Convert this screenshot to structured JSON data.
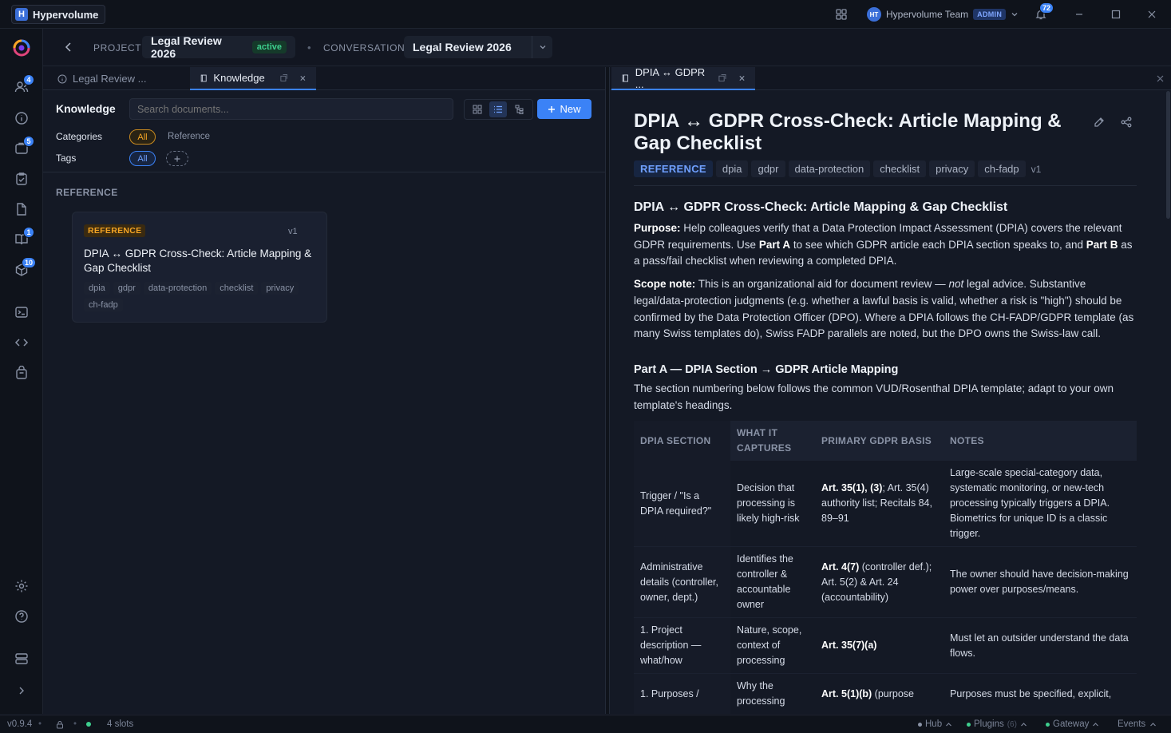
{
  "app": {
    "name": "Hypervolume",
    "logo_letter": "H",
    "version": "v0.9.4",
    "slots": "4 slots"
  },
  "titlebar": {
    "team_initials": "HT",
    "team_name": "Hypervolume Team",
    "role": "ADMIN",
    "notif_count": "72"
  },
  "rail": {
    "team_badge": "4",
    "jobs_badge": "5",
    "books_badge": "1",
    "models_badge": "10"
  },
  "header": {
    "project_label": "PROJECT",
    "project_name": "Legal Review 2026",
    "project_status": "active",
    "conversation_label": "CONVERSATION",
    "conversation_name": "Legal Review 2026"
  },
  "left": {
    "tabs": [
      {
        "label": "Legal Review ..."
      },
      {
        "label": "Knowledge"
      }
    ],
    "knowledge_title": "Knowledge",
    "search_placeholder": "Search documents...",
    "new_button": "New",
    "categories_label": "Categories",
    "categories": [
      "All",
      "Reference"
    ],
    "tags_label": "Tags",
    "tags_all": "All",
    "section_title": "REFERENCE",
    "card": {
      "badge": "REFERENCE",
      "version": "v1",
      "title": "DPIA ↔ GDPR Cross-Check: Article Mapping & Gap Checklist",
      "tags": [
        "dpia",
        "gdpr",
        "data-protection",
        "checklist",
        "privacy",
        "ch-fadp"
      ]
    }
  },
  "right": {
    "tab_label": "DPIA ↔ GDPR ...",
    "doc_title": "DPIA ↔ GDPR Cross-Check: Article Mapping & Gap Checklist",
    "category": "REFERENCE",
    "tags": [
      "dpia",
      "gdpr",
      "data-protection",
      "checklist",
      "privacy",
      "ch-fadp"
    ],
    "version": "v1",
    "h2": "DPIA ↔ GDPR Cross-Check: Article Mapping & Gap Checklist",
    "purpose_label": "Purpose:",
    "purpose_1": " Help colleagues verify that a Data Protection Impact Assessment (DPIA) covers the relevant GDPR requirements. Use ",
    "purpose_parta": "Part A",
    "purpose_2": " to see which GDPR article each DPIA section speaks to, and ",
    "purpose_partb": "Part B",
    "purpose_3": " as a pass/fail checklist when reviewing a completed DPIA.",
    "scope_label": "Scope note:",
    "scope_1": " This is an organizational aid for document review — ",
    "scope_not": "not",
    "scope_2": " legal advice. Substantive legal/data-protection judgments (e.g. whether a lawful basis is valid, whether a risk is \"high\") should be confirmed by the Data Protection Officer (DPO). Where a DPIA follows the CH-FADP/GDPR template (as many Swiss templates do), Swiss FADP parallels are noted, but the DPO owns the Swiss-law call.",
    "parta_heading": "Part A — DPIA Section → GDPR Article Mapping",
    "parta_intro": "The section numbering below follows the common VUD/Rosenthal DPIA template; adapt to your own template's headings.",
    "table_headers": [
      "DPIA SECTION",
      "WHAT IT CAPTURES",
      "PRIMARY GDPR BASIS",
      "NOTES"
    ],
    "rows": [
      {
        "section": "Trigger / \"Is a DPIA required?\"",
        "captures": "Decision that processing is likely high-risk",
        "basis_bold": "Art. 35(1), (3)",
        "basis_rest": "; Art. 35(4) authority list; Recitals 84, 89–91",
        "notes": "Large-scale special-category data, systematic monitoring, or new-tech processing typically triggers a DPIA. Biometrics for unique ID is a classic trigger."
      },
      {
        "section": "Administrative details (controller, owner, dept.)",
        "captures": "Identifies the controller & accountable owner",
        "basis_bold": "Art. 4(7)",
        "basis_rest": " (controller def.); Art. 5(2) & Art. 24 (accountability)",
        "notes": "The owner should have decision-making power over purposes/means."
      },
      {
        "section": "1. Project description — what/how",
        "captures": "Nature, scope, context of processing",
        "basis_bold": "Art. 35(7)(a)",
        "basis_rest": "",
        "notes": "Must let an outsider understand the data flows."
      },
      {
        "section": "1. Purposes /",
        "captures": "Why the processing",
        "basis_bold": "Art. 5(1)(b)",
        "basis_rest": " (purpose",
        "notes": "Purposes must be specified, explicit,"
      }
    ]
  },
  "status": {
    "hub": "Hub",
    "plugins": "Plugins",
    "plugins_count": "(6)",
    "gateway": "Gateway",
    "events": "Events"
  }
}
